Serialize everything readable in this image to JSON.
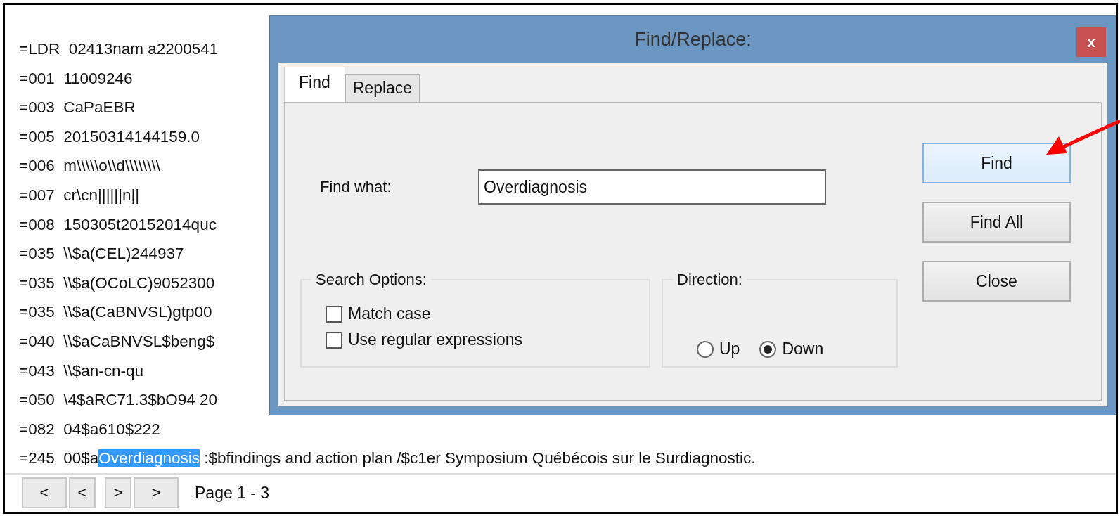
{
  "record_lines": [
    {
      "text": "=LDR  02413nam a2200541"
    },
    {
      "text": "=001  11009246"
    },
    {
      "text": "=003  CaPaEBR"
    },
    {
      "text": "=005  20150314144159.0"
    },
    {
      "text": "=006  m\\\\\\\\\\o\\\\d\\\\\\\\\\\\\\\\"
    },
    {
      "text": "=007  cr\\cn||||||n||"
    },
    {
      "text": "=008  150305t20152014quc"
    },
    {
      "text": "=035  \\\\$a(CEL)244937"
    },
    {
      "text": "=035  \\\\$a(OCoLC)9052300"
    },
    {
      "text": "=035  \\\\$a(CaBNVSL)gtp00"
    },
    {
      "text": "=040  \\\\$aCaBNVSL$beng$"
    },
    {
      "text": "=043  \\\\$an-cn-qu"
    },
    {
      "text": "=050  \\4$aRC71.3$bO94 20"
    },
    {
      "text": "=082  04$a610$222"
    },
    {
      "text": "=245  00$a",
      "match": "Overdiagnosis",
      "rest": " :$bfindings and action plan /$c1er Symposium Québécois sur le Surdiagnostic."
    }
  ],
  "pager": {
    "buttons": [
      "<",
      "<",
      ">",
      ">"
    ],
    "label": "Page 1 - 3"
  },
  "dialog": {
    "title": "Find/Replace:",
    "close": "x",
    "tabs": [
      {
        "label": "Find",
        "selected": true
      },
      {
        "label": "Replace",
        "selected": false
      }
    ],
    "find_what": {
      "label": "Find what:",
      "value": "Overdiagnosis"
    },
    "search_options": {
      "title": "Search Options:",
      "options": [
        {
          "label": "Match case",
          "checked": false
        },
        {
          "label": "Use regular expressions",
          "checked": false
        }
      ]
    },
    "direction": {
      "title": "Direction:",
      "options": [
        {
          "label": "Up",
          "selected": false
        },
        {
          "label": "Down",
          "selected": true
        }
      ]
    },
    "buttons": [
      {
        "label": "Find",
        "highlighted": true
      },
      {
        "label": "Find All",
        "highlighted": false
      },
      {
        "label": "Close",
        "highlighted": false
      }
    ]
  }
}
